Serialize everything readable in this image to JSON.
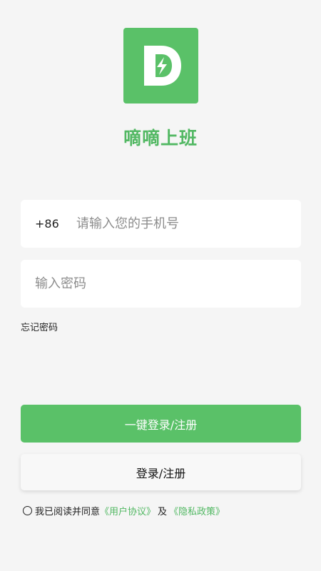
{
  "app": {
    "name": "嘀嘀上班",
    "brand_color": "#5ac168",
    "logo_icon": "bolt-d-logo-icon"
  },
  "login": {
    "country_code": "+86",
    "phone_placeholder": "请输入您的手机号",
    "password_placeholder": "输入密码",
    "forgot_password": "忘记密码",
    "one_click_button": "一键登录/注册",
    "login_button": "登录/注册"
  },
  "agreement": {
    "prefix": "我已阅读并同意",
    "user_agreement": "《用户协议》",
    "conjunction": "及",
    "privacy_policy": "《隐私政策》",
    "checked": false
  }
}
